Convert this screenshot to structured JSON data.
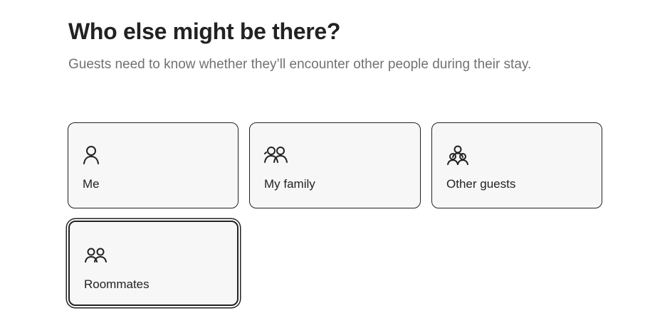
{
  "header": {
    "title": "Who else might be there?",
    "subtitle": "Guests need to know whether they’ll encounter other people during their stay."
  },
  "options": [
    {
      "label": "Me",
      "icon": "single-person-icon",
      "selected": false
    },
    {
      "label": "My family",
      "icon": "family-icon",
      "selected": false
    },
    {
      "label": "Other guests",
      "icon": "other-guests-icon",
      "selected": false
    },
    {
      "label": "Roommates",
      "icon": "roommates-icon",
      "selected": true
    }
  ]
}
